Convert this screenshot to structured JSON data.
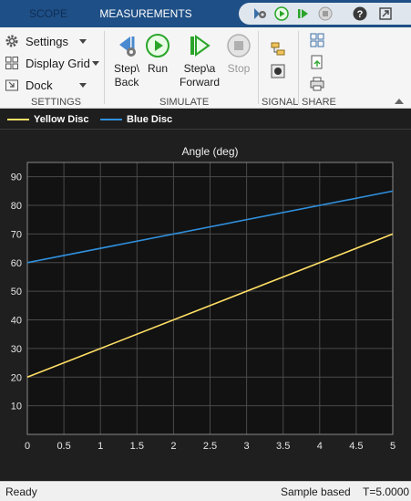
{
  "tabs": [
    {
      "label": "SCOPE",
      "active": false
    },
    {
      "label": "MEASUREMENTS",
      "active": true
    }
  ],
  "quick_access": {
    "icons": [
      "debug-icon",
      "run-icon",
      "step-forward-icon",
      "stop-icon",
      "help-icon",
      "undock-icon"
    ]
  },
  "ribbon": {
    "settings": {
      "section_label": "SETTINGS",
      "items": [
        {
          "label": "Settings",
          "icon": "gear-icon"
        },
        {
          "label": "Display Grid",
          "icon": "grid-icon"
        },
        {
          "label": "Dock",
          "icon": "dock-icon"
        }
      ]
    },
    "simulate": {
      "section_label": "SIMULATE",
      "buttons": [
        {
          "label": "Step\\\nBack",
          "icon": "step-back-icon"
        },
        {
          "label": "Run",
          "icon": "run-icon"
        },
        {
          "label": "Step\\a\nForward",
          "icon": "step-forward-icon"
        },
        {
          "label": "Stop",
          "icon": "stop-icon"
        }
      ]
    },
    "signal": {
      "section_label": "SIGNAL"
    },
    "share": {
      "section_label": "SHARE"
    }
  },
  "colors": {
    "yellow": "#ffe066",
    "blue": "#2f8fdc",
    "plot_bg": "#121212",
    "grid": "#4a4a4a"
  },
  "chart_data": {
    "type": "line",
    "title": "Angle (deg)",
    "xlim": [
      0,
      5
    ],
    "ylim": [
      0,
      95
    ],
    "xticks": [
      0,
      0.5,
      1,
      1.5,
      2,
      2.5,
      3,
      3.5,
      4,
      4.5,
      5
    ],
    "yticks": [
      10,
      20,
      30,
      40,
      50,
      60,
      70,
      80,
      90
    ],
    "grid": true,
    "legend_position": "top",
    "series": [
      {
        "name": "Yellow Disc",
        "color": "#ffe066",
        "x": [
          0,
          5
        ],
        "y": [
          20,
          70
        ]
      },
      {
        "name": "Blue Disc",
        "color": "#2f8fdc",
        "x": [
          0,
          5
        ],
        "y": [
          60,
          85
        ]
      }
    ]
  },
  "status": {
    "left": "Ready",
    "mode": "Sample based",
    "time": "T=5.0000"
  }
}
